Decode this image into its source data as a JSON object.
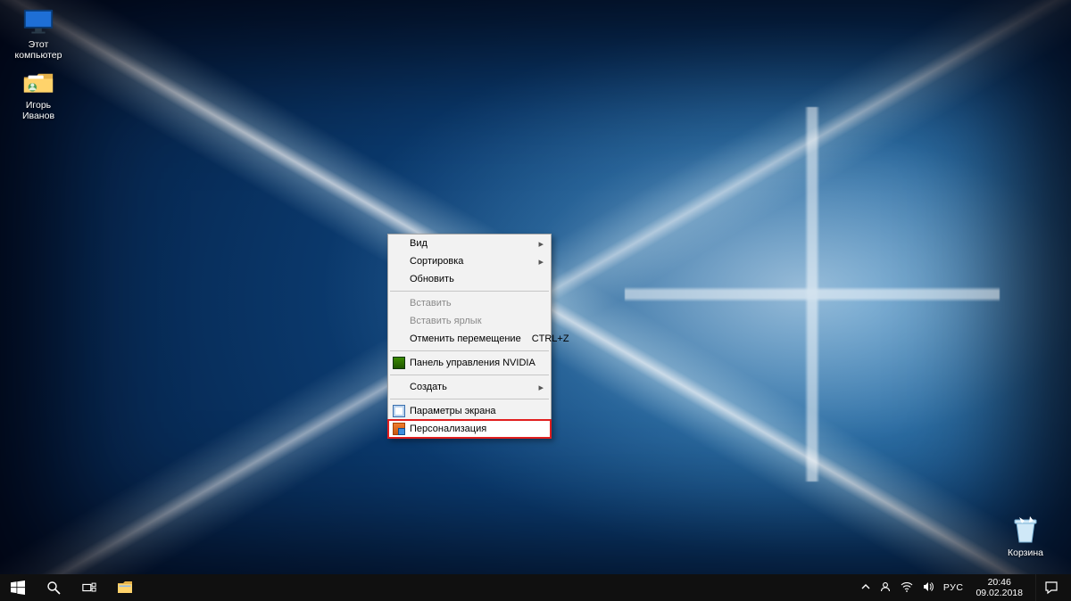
{
  "desktop": {
    "icons": [
      {
        "id": "this-pc",
        "label": "Этот\nкомпьютер"
      },
      {
        "id": "user-home",
        "label": "Игорь\nИванов"
      }
    ],
    "recycle_bin_label": "Корзина"
  },
  "context_menu": {
    "items": [
      {
        "id": "view",
        "label": "Вид",
        "submenu": true
      },
      {
        "id": "sort",
        "label": "Сортировка",
        "submenu": true
      },
      {
        "id": "refresh",
        "label": "Обновить"
      },
      {
        "sep": true
      },
      {
        "id": "paste",
        "label": "Вставить",
        "disabled": true
      },
      {
        "id": "paste-shortcut",
        "label": "Вставить ярлык",
        "disabled": true
      },
      {
        "id": "undo-move",
        "label": "Отменить перемещение",
        "shortcut": "CTRL+Z"
      },
      {
        "sep": true
      },
      {
        "id": "nvidia-panel",
        "label": "Панель управления NVIDIA",
        "icon": "nvidia"
      },
      {
        "sep": true
      },
      {
        "id": "new",
        "label": "Создать",
        "submenu": true
      },
      {
        "sep": true
      },
      {
        "id": "display-settings",
        "label": "Параметры экрана",
        "icon": "disp"
      },
      {
        "id": "personalize",
        "label": "Персонализация",
        "icon": "pers",
        "highlight": true
      }
    ]
  },
  "taskbar": {
    "start_tooltip": "Пуск",
    "search_tooltip": "Поиск",
    "taskview_tooltip": "Представление задач",
    "explorer_tooltip": "Проводник",
    "tray": {
      "lang": "РУС",
      "time": "20:46",
      "date": "09.02.2018"
    }
  }
}
